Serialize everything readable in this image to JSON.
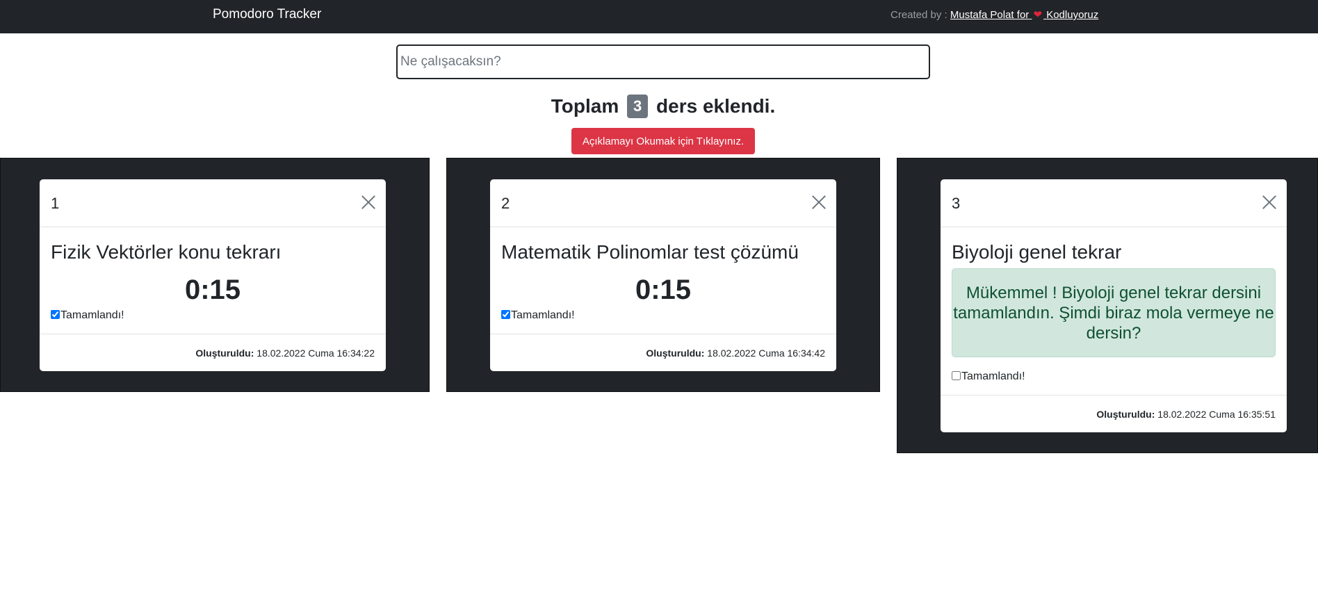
{
  "navbar": {
    "brand": "Pomodoro Tracker",
    "credit_prefix": "Created by :",
    "credit_link_before": "Mustafa Polat for",
    "credit_link_after": "Kodluyoruz",
    "heart": "❤",
    "heart_color": "#e0243a"
  },
  "search": {
    "placeholder": "Ne çalışacaksın?",
    "value": ""
  },
  "summary": {
    "before": "Toplam",
    "count": "3",
    "after": "ders eklendi."
  },
  "info_button": {
    "label": "Açıklamayı Okumak için Tıklayınız.",
    "color": "#dc3545"
  },
  "cards": [
    {
      "number": "1",
      "title": "Fizik Vektörler konu tekrarı",
      "timer": "0:15",
      "completed": true,
      "completed_label": "Tamamlandı!",
      "created_label": "Oluşturuldu:",
      "created_value": "18.02.2022 Cuma 16:34:22"
    },
    {
      "number": "2",
      "title": "Matematik Polinomlar test çözümü",
      "timer": "0:15",
      "completed": true,
      "completed_label": "Tamamlandı!",
      "created_label": "Oluşturuldu:",
      "created_value": "18.02.2022 Cuma 16:34:42"
    },
    {
      "number": "3",
      "title": "Biyoloji genel tekrar",
      "message": "Mükemmel ! Biyoloji genel tekrar dersini tamamlandın. Şimdi biraz mola vermeye ne dersin?",
      "completed": false,
      "completed_label": "Tamamlandı!",
      "created_label": "Oluşturuldu:",
      "created_value": "18.02.2022 Cuma 16:35:51"
    }
  ]
}
